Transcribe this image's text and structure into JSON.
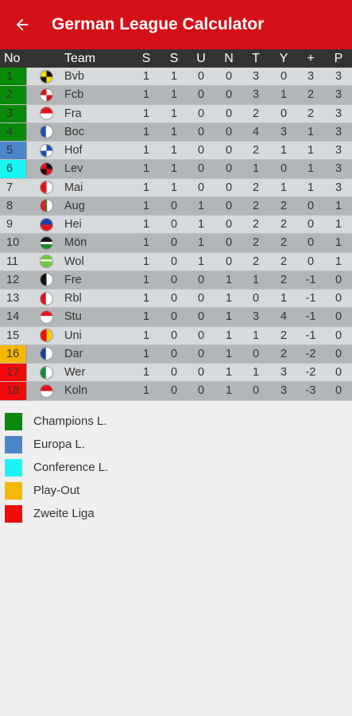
{
  "app": {
    "title": "German League Calculator"
  },
  "colors": {
    "appbar": "#d50f16",
    "champions": "#0a8a0a",
    "europa": "#4a86c8",
    "conference": "#19f5f5",
    "playout": "#f6b800",
    "relegation": "#f20a0a"
  },
  "table": {
    "headers": {
      "no": "No",
      "team": "Team",
      "s1": "S",
      "s2": "S",
      "u": "U",
      "n": "N",
      "t": "T",
      "y": "Y",
      "pm": "+",
      "p": "P"
    },
    "rows": [
      {
        "no": "1",
        "team": "Bvb",
        "s1": "1",
        "s2": "1",
        "u": "0",
        "n": "0",
        "t": "3",
        "y": "0",
        "pm": "3",
        "p": "3",
        "zone": "champions",
        "logo": "bvb-logo"
      },
      {
        "no": "2",
        "team": "Fcb",
        "s1": "1",
        "s2": "1",
        "u": "0",
        "n": "0",
        "t": "3",
        "y": "1",
        "pm": "2",
        "p": "3",
        "zone": "champions",
        "logo": "fcb-logo"
      },
      {
        "no": "3",
        "team": "Fra",
        "s1": "1",
        "s2": "1",
        "u": "0",
        "n": "0",
        "t": "2",
        "y": "0",
        "pm": "2",
        "p": "3",
        "zone": "champions",
        "logo": "fra-logo"
      },
      {
        "no": "4",
        "team": "Boc",
        "s1": "1",
        "s2": "1",
        "u": "0",
        "n": "0",
        "t": "4",
        "y": "3",
        "pm": "1",
        "p": "3",
        "zone": "champions",
        "logo": "boc-logo"
      },
      {
        "no": "5",
        "team": "Hof",
        "s1": "1",
        "s2": "1",
        "u": "0",
        "n": "0",
        "t": "2",
        "y": "1",
        "pm": "1",
        "p": "3",
        "zone": "europa",
        "logo": "hof-logo"
      },
      {
        "no": "6",
        "team": "Lev",
        "s1": "1",
        "s2": "1",
        "u": "0",
        "n": "0",
        "t": "1",
        "y": "0",
        "pm": "1",
        "p": "3",
        "zone": "conference",
        "logo": "lev-logo"
      },
      {
        "no": "7",
        "team": "Mai",
        "s1": "1",
        "s2": "1",
        "u": "0",
        "n": "0",
        "t": "2",
        "y": "1",
        "pm": "1",
        "p": "3",
        "zone": "",
        "logo": "mai-logo"
      },
      {
        "no": "8",
        "team": "Aug",
        "s1": "1",
        "s2": "0",
        "u": "1",
        "n": "0",
        "t": "2",
        "y": "2",
        "pm": "0",
        "p": "1",
        "zone": "",
        "logo": "aug-logo"
      },
      {
        "no": "9",
        "team": "Hei",
        "s1": "1",
        "s2": "0",
        "u": "1",
        "n": "0",
        "t": "2",
        "y": "2",
        "pm": "0",
        "p": "1",
        "zone": "",
        "logo": "hei-logo"
      },
      {
        "no": "10",
        "team": "Mön",
        "s1": "1",
        "s2": "0",
        "u": "1",
        "n": "0",
        "t": "2",
        "y": "2",
        "pm": "0",
        "p": "1",
        "zone": "",
        "logo": "mon-logo"
      },
      {
        "no": "11",
        "team": "Wol",
        "s1": "1",
        "s2": "0",
        "u": "1",
        "n": "0",
        "t": "2",
        "y": "2",
        "pm": "0",
        "p": "1",
        "zone": "",
        "logo": "wol-logo"
      },
      {
        "no": "12",
        "team": "Fre",
        "s1": "1",
        "s2": "0",
        "u": "0",
        "n": "1",
        "t": "1",
        "y": "2",
        "pm": "-1",
        "p": "0",
        "zone": "",
        "logo": "fre-logo"
      },
      {
        "no": "13",
        "team": "Rbl",
        "s1": "1",
        "s2": "0",
        "u": "0",
        "n": "1",
        "t": "0",
        "y": "1",
        "pm": "-1",
        "p": "0",
        "zone": "",
        "logo": "rbl-logo"
      },
      {
        "no": "14",
        "team": "Stu",
        "s1": "1",
        "s2": "0",
        "u": "0",
        "n": "1",
        "t": "3",
        "y": "4",
        "pm": "-1",
        "p": "0",
        "zone": "",
        "logo": "stu-logo"
      },
      {
        "no": "15",
        "team": "Uni",
        "s1": "1",
        "s2": "0",
        "u": "0",
        "n": "1",
        "t": "1",
        "y": "2",
        "pm": "-1",
        "p": "0",
        "zone": "",
        "logo": "uni-logo"
      },
      {
        "no": "16",
        "team": "Dar",
        "s1": "1",
        "s2": "0",
        "u": "0",
        "n": "1",
        "t": "0",
        "y": "2",
        "pm": "-2",
        "p": "0",
        "zone": "playout",
        "logo": "dar-logo"
      },
      {
        "no": "17",
        "team": "Wer",
        "s1": "1",
        "s2": "0",
        "u": "0",
        "n": "1",
        "t": "1",
        "y": "3",
        "pm": "-2",
        "p": "0",
        "zone": "relegation",
        "logo": "wer-logo"
      },
      {
        "no": "18",
        "team": "Koln",
        "s1": "1",
        "s2": "0",
        "u": "0",
        "n": "1",
        "t": "0",
        "y": "3",
        "pm": "-3",
        "p": "0",
        "zone": "relegation",
        "logo": "koln-logo"
      }
    ]
  },
  "legend": [
    {
      "label": "Champions L.",
      "zone": "champions"
    },
    {
      "label": "Europa L.",
      "zone": "europa"
    },
    {
      "label": "Conference L.",
      "zone": "conference"
    },
    {
      "label": "Play-Out",
      "zone": "playout"
    },
    {
      "label": "Zweite Liga",
      "zone": "relegation"
    }
  ]
}
